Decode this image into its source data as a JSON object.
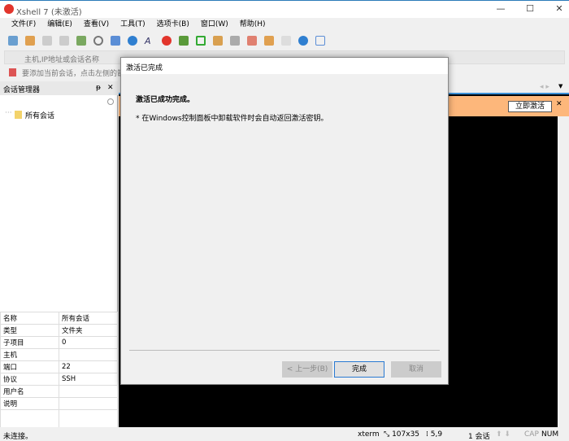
{
  "window": {
    "title": "Xshell 7 (未激活)",
    "minimize": "—",
    "maximize": "☐",
    "close": "✕"
  },
  "menu": [
    "文件(F)",
    "编辑(E)",
    "查看(V)",
    "工具(T)",
    "选项卡(B)",
    "窗口(W)",
    "帮助(H)"
  ],
  "address": {
    "placeholder": "主机,IP地址或会话名称"
  },
  "hint": "要添加当前会话，点击左侧的箭头按钮。",
  "session_manager": {
    "title": "会话管理器",
    "pin": "ᵽ",
    "close": "✕",
    "tree": [
      "所有会话"
    ]
  },
  "properties": [
    [
      "名称",
      "所有会话"
    ],
    [
      "类型",
      "文件夹"
    ],
    [
      "子项目",
      "0"
    ],
    [
      "主机",
      ""
    ],
    [
      "端口",
      "22"
    ],
    [
      "协议",
      "SSH"
    ],
    [
      "用户名",
      ""
    ],
    [
      "说明",
      ""
    ],
    [
      "",
      ""
    ]
  ],
  "banner": {
    "button": "立即激活",
    "close": "✕"
  },
  "dialog": {
    "title": "激活已完成",
    "heading": "激活已成功完成。",
    "note": "* 在Windows控制面板中卸载软件时会自动返回激活密钥。",
    "back": "< 上一步(B)",
    "finish": "完成",
    "cancel": "取消"
  },
  "status": {
    "left": "未连接。",
    "term": "xterm",
    "size": "107x35",
    "pos": "5,9",
    "sessions": "1 会话",
    "cap": "CAP",
    "num": "NUM"
  }
}
